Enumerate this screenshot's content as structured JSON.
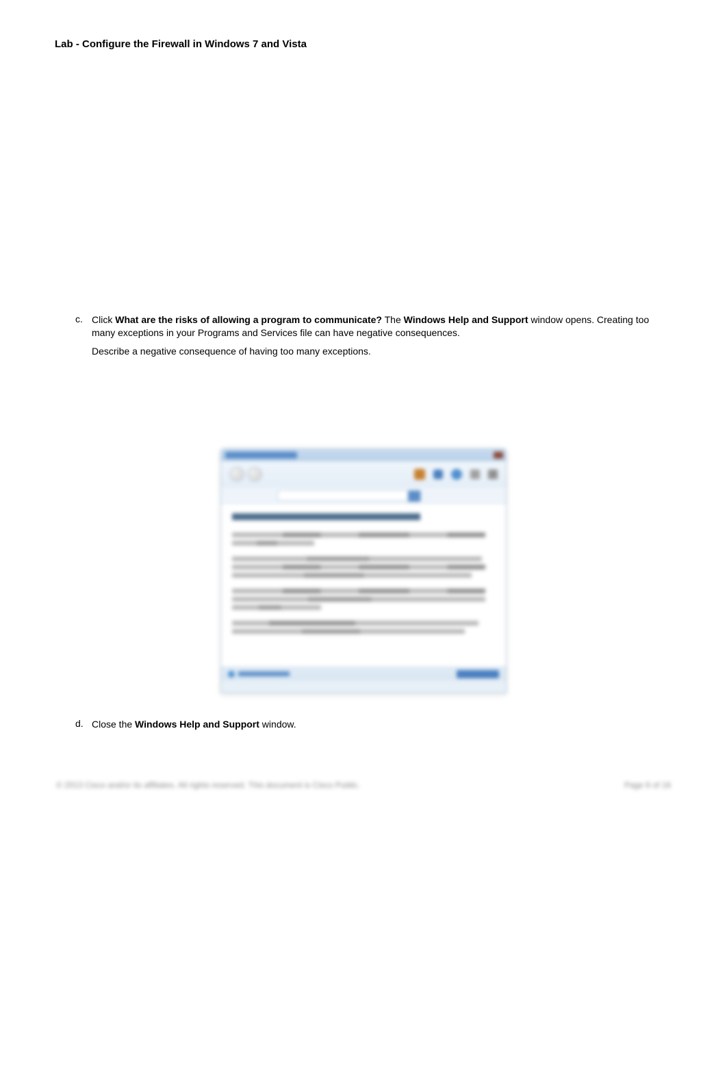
{
  "header": {
    "title": "Lab - Configure the Firewall in Windows 7 and Vista"
  },
  "items": {
    "c": {
      "marker": "c.",
      "text_pre": "Click ",
      "bold1": "What are the risks of allowing a program to communicate?",
      "text_mid": " The ",
      "bold2": "Windows Help and Support",
      "text_post": " window opens. Creating too many exceptions in your Programs and Services file can have negative consequences.",
      "question": "Describe a negative consequence of having too many exceptions."
    },
    "d": {
      "marker": "d.",
      "text_pre": "Close the ",
      "bold1": "Windows Help and Support",
      "text_post": " window."
    }
  },
  "footer": {
    "left": "© 2013 Cisco and/or its affiliates. All rights reserved. This document is Cisco Public.",
    "right": "Page 6 of 16"
  }
}
